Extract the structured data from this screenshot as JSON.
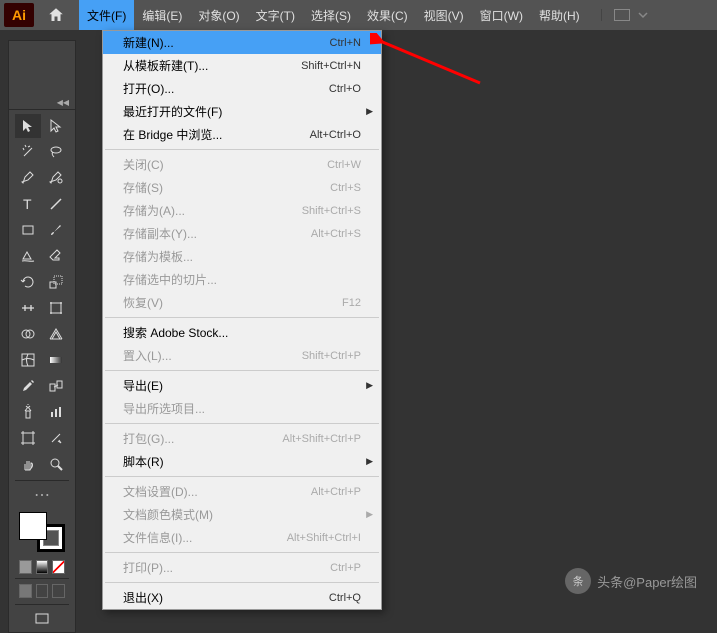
{
  "app": {
    "logo_text": "Ai"
  },
  "menubar": {
    "items": [
      {
        "label": "文件(F)",
        "active": true
      },
      {
        "label": "编辑(E)"
      },
      {
        "label": "对象(O)"
      },
      {
        "label": "文字(T)"
      },
      {
        "label": "选择(S)"
      },
      {
        "label": "效果(C)"
      },
      {
        "label": "视图(V)"
      },
      {
        "label": "窗口(W)"
      },
      {
        "label": "帮助(H)"
      }
    ]
  },
  "dropdown": {
    "groups": [
      [
        {
          "label": "新建(N)...",
          "shortcut": "Ctrl+N",
          "highlighted": true
        },
        {
          "label": "从模板新建(T)...",
          "shortcut": "Shift+Ctrl+N"
        },
        {
          "label": "打开(O)...",
          "shortcut": "Ctrl+O"
        },
        {
          "label": "最近打开的文件(F)",
          "submenu": true
        },
        {
          "label": "在 Bridge 中浏览...",
          "shortcut": "Alt+Ctrl+O"
        }
      ],
      [
        {
          "label": "关闭(C)",
          "shortcut": "Ctrl+W",
          "disabled": true
        },
        {
          "label": "存储(S)",
          "shortcut": "Ctrl+S",
          "disabled": true
        },
        {
          "label": "存储为(A)...",
          "shortcut": "Shift+Ctrl+S",
          "disabled": true
        },
        {
          "label": "存储副本(Y)...",
          "shortcut": "Alt+Ctrl+S",
          "disabled": true
        },
        {
          "label": "存储为模板...",
          "disabled": true
        },
        {
          "label": "存储选中的切片...",
          "disabled": true
        },
        {
          "label": "恢复(V)",
          "shortcut": "F12",
          "disabled": true
        }
      ],
      [
        {
          "label": "搜索 Adobe Stock..."
        },
        {
          "label": "置入(L)...",
          "shortcut": "Shift+Ctrl+P",
          "disabled": true
        }
      ],
      [
        {
          "label": "导出(E)",
          "submenu": true
        },
        {
          "label": "导出所选项目...",
          "disabled": true
        }
      ],
      [
        {
          "label": "打包(G)...",
          "shortcut": "Alt+Shift+Ctrl+P",
          "disabled": true
        },
        {
          "label": "脚本(R)",
          "submenu": true
        }
      ],
      [
        {
          "label": "文档设置(D)...",
          "shortcut": "Alt+Ctrl+P",
          "disabled": true
        },
        {
          "label": "文档颜色模式(M)",
          "submenu": true,
          "disabled": true
        },
        {
          "label": "文件信息(I)...",
          "shortcut": "Alt+Shift+Ctrl+I",
          "disabled": true
        }
      ],
      [
        {
          "label": "打印(P)...",
          "shortcut": "Ctrl+P",
          "disabled": true
        }
      ],
      [
        {
          "label": "退出(X)",
          "shortcut": "Ctrl+Q"
        }
      ]
    ]
  },
  "watermark": {
    "text": "头条@Paper绘图"
  }
}
